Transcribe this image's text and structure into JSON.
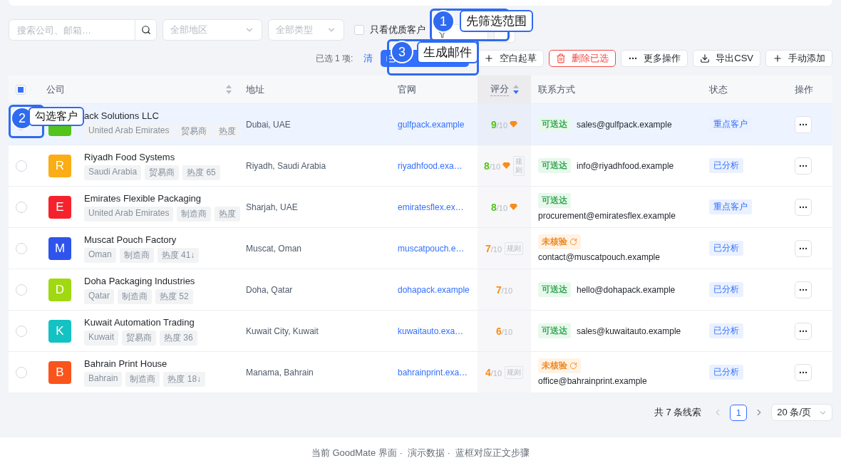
{
  "filters": {
    "search": {
      "placeholder": "搜索公司、邮箱…"
    },
    "selects": [
      {
        "placeholder": "全部地区"
      },
      {
        "placeholder": "全部类型"
      }
    ],
    "premium_only": {
      "label": "只看优质客户",
      "checked": false
    }
  },
  "selection": {
    "label": "已选 1 项:",
    "clear": "清"
  },
  "actions": [
    {
      "label": "空白起草",
      "kind": "plus"
    },
    {
      "label": "删除已选",
      "kind": "delete"
    },
    {
      "label": "更多操作",
      "kind": "more"
    },
    {
      "label": "导出CSV",
      "kind": "download"
    },
    {
      "label": "手动添加",
      "kind": "plus"
    }
  ],
  "table": {
    "select_all_partial": true,
    "columns": [
      {
        "label": "公司",
        "sortable": true,
        "sorted": false
      },
      {
        "label": "地址",
        "sortable": false,
        "sorted": false
      },
      {
        "label": "官网",
        "sortable": false,
        "sorted": false
      },
      {
        "label": "评分",
        "sortable": true,
        "sorted": true
      },
      {
        "label": "联系方式",
        "sortable": false,
        "sorted": false
      },
      {
        "label": "状态",
        "sortable": false,
        "sorted": false
      },
      {
        "label": "操作",
        "sortable": false,
        "sorted": false
      }
    ],
    "rows": [
      {
        "selected": true,
        "avatar": {
          "color": "#52c41a"
        },
        "name": "ack Solutions LLC",
        "tags": [
          "United Arab Emirates",
          "贸易商",
          "热度"
        ],
        "address": "Dubai, UAE",
        "website": "gulfpack.example",
        "score": {
          "value": "9",
          "max": "/10",
          "color": "#52c41a",
          "gem": true
        },
        "contact": {
          "check": {
            "label": "可送达",
            "kind": "verified"
          },
          "email": "sales@gulfpack.example"
        },
        "status": "重点客户"
      },
      {
        "selected": false,
        "avatar": {
          "letter": "R",
          "color": "#faad14"
        },
        "name": "Riyadh Food Systems",
        "tags": [
          "Saudi Arabia",
          "贸易商",
          "热度 65"
        ],
        "address": "Riyadh, Saudi Arabia",
        "website": "riyadhfood.exa…",
        "score": {
          "value": "8",
          "max": "/10",
          "color": "#52c41a",
          "gem": true,
          "rule": "规则"
        },
        "contact": {
          "check": {
            "label": "可送达",
            "kind": "verified"
          },
          "email": "info@riyadhfood.example"
        },
        "status": "已分析"
      },
      {
        "selected": false,
        "avatar": {
          "letter": "E",
          "color": "#f5222d"
        },
        "name": "Emirates Flexible Packaging",
        "tags": [
          "United Arab Emirates",
          "制造商",
          "热度"
        ],
        "address": "Sharjah, UAE",
        "website": "emiratesflex.ex…",
        "score": {
          "value": "8",
          "max": "/10",
          "color": "#52c41a",
          "gem": true
        },
        "contact": {
          "check": {
            "label": "可送达",
            "kind": "verified"
          },
          "email": "procurement@emiratesflex.example"
        },
        "status": "重点客户"
      },
      {
        "selected": false,
        "avatar": {
          "letter": "M",
          "color": "#2f54eb"
        },
        "name": "Muscat Pouch Factory",
        "tags": [
          "Oman",
          "制造商",
          "热度 41↓"
        ],
        "address": "Muscat, Oman",
        "website": "muscatpouch.e…",
        "score": {
          "value": "7",
          "max": "/10",
          "color": "#fa8c16",
          "gem": false,
          "rule": "规则"
        },
        "contact": {
          "check": {
            "label": "未核验",
            "kind": "unverified"
          },
          "email": "contact@muscatpouch.example"
        },
        "status": "已分析"
      },
      {
        "selected": false,
        "avatar": {
          "letter": "D",
          "color": "#a0d911"
        },
        "name": "Doha Packaging Industries",
        "tags": [
          "Qatar",
          "制造商",
          "热度 52"
        ],
        "address": "Doha, Qatar",
        "website": "dohapack.example",
        "score": {
          "value": "7",
          "max": "/10",
          "color": "#fa8c16",
          "gem": false
        },
        "contact": {
          "check": {
            "label": "可送达",
            "kind": "verified"
          },
          "email": "hello@dohapack.example"
        },
        "status": "已分析"
      },
      {
        "selected": false,
        "avatar": {
          "letter": "K",
          "color": "#13c2c2"
        },
        "name": "Kuwait Automation Trading",
        "tags": [
          "Kuwait",
          "贸易商",
          "热度 36"
        ],
        "address": "Kuwait City, Kuwait",
        "website": "kuwaitauto.exa…",
        "score": {
          "value": "6",
          "max": "/10",
          "color": "#fa8c16",
          "gem": false
        },
        "contact": {
          "check": {
            "label": "可送达",
            "kind": "verified"
          },
          "email": "sales@kuwaitauto.example"
        },
        "status": "已分析"
      },
      {
        "selected": false,
        "avatar": {
          "letter": "B",
          "color": "#fa541c"
        },
        "name": "Bahrain Print House",
        "tags": [
          "Bahrain",
          "制造商",
          "热度 18↓"
        ],
        "address": "Manama, Bahrain",
        "website": "bahrainprint.exa…",
        "score": {
          "value": "4",
          "max": "/10",
          "color": "#fa8c16",
          "gem": false,
          "rule": "规则"
        },
        "contact": {
          "check": {
            "label": "未核验",
            "kind": "unverified"
          },
          "email": "office@bahrainprint.example"
        },
        "status": "已分析"
      }
    ]
  },
  "pagination": {
    "total": "共 7 条线索",
    "pages": [
      {
        "label": "1",
        "selected": true
      }
    ],
    "page_size": "20 条/页"
  },
  "footer": "当前 GoodMate 界面 ·  演示数据 ·  蓝框对应正文步骤",
  "callouts": [
    {
      "number": "1",
      "label": "先筛选范围"
    },
    {
      "number": "2",
      "label": "勾选客户"
    },
    {
      "number": "3",
      "label": "生成邮件"
    }
  ]
}
